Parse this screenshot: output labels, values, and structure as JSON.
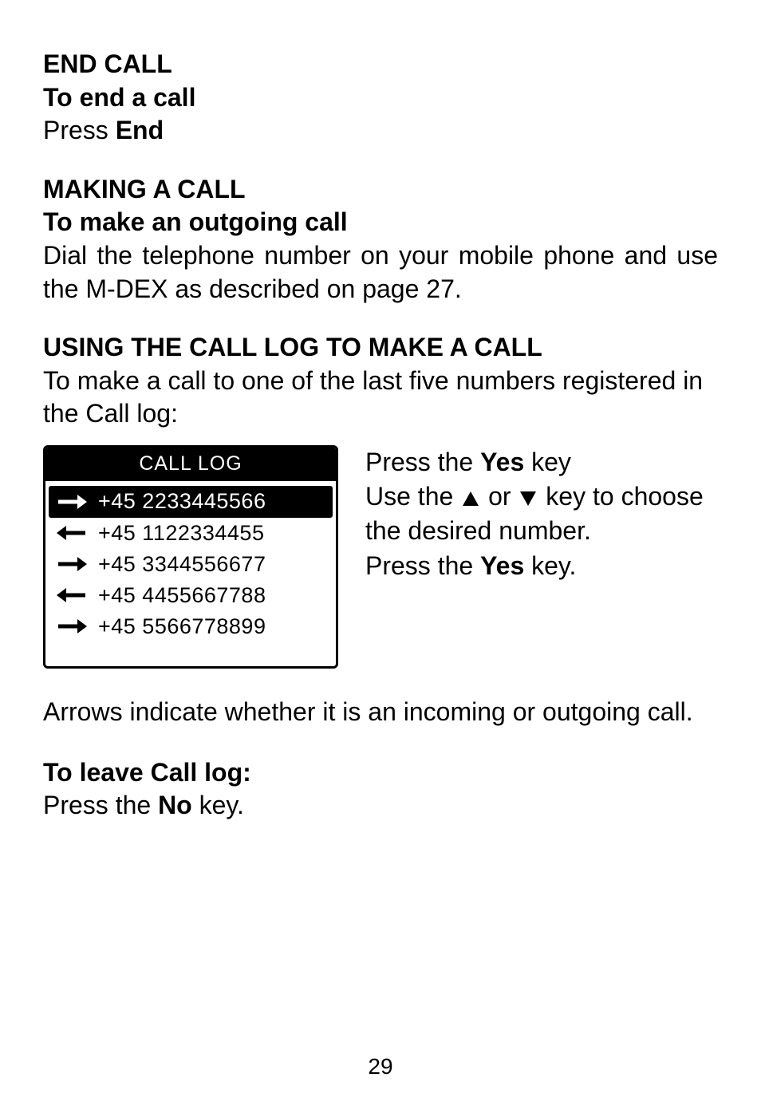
{
  "endcall": {
    "heading": "END CALL",
    "sub": "To end a call",
    "press_word": "Press ",
    "end_word": "End"
  },
  "making": {
    "heading": "MAKING A CALL",
    "sub": "To make an outgoing call",
    "body": "Dial the telephone number on your mobile phone and use the M-DEX as described on page 27."
  },
  "usinglog": {
    "heading": "USING THE CALL LOG TO MAKE A CALL",
    "body": "To make a call to one of the last five numbers registered in the Call log:"
  },
  "calllog": {
    "title": "CALL LOG",
    "entries": [
      {
        "dir": "out",
        "number": "+45 2233445566",
        "selected": true
      },
      {
        "dir": "in",
        "number": "+45 1122334455",
        "selected": false
      },
      {
        "dir": "out",
        "number": "+45 3344556677",
        "selected": false
      },
      {
        "dir": "in",
        "number": "+45 4455667788",
        "selected": false
      },
      {
        "dir": "out",
        "number": "+45 5566778899",
        "selected": false
      }
    ]
  },
  "sidetext": {
    "l1a": "Press the ",
    "l1b": "Yes",
    "l1c": " key",
    "l2a": "Use the ",
    "l2b": " or ",
    "l2c": " key to choose the desired number.",
    "l3a": "Press the ",
    "l3b": "Yes",
    "l3c": " key."
  },
  "arrows_note": "Arrows indicate whether it is an incoming or outgoing call.",
  "leave": {
    "heading": "To leave Call log:",
    "l1a": "Press the ",
    "l1b": "No",
    "l1c": " key."
  },
  "page_number": "29"
}
